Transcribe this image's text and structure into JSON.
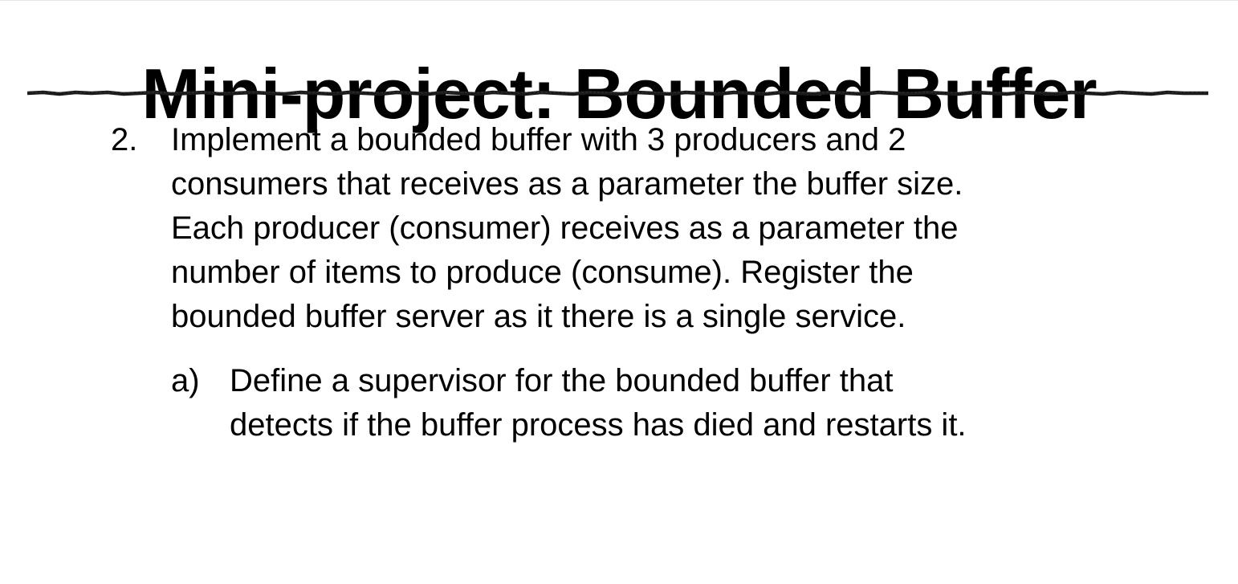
{
  "slide": {
    "title": "Mini-project: Bounded Buffer",
    "item": {
      "number": "2.",
      "text": "Implement a bounded buffer with 3 producers and 2\nconsumers that receives as a parameter the buffer size.\nEach producer (consumer) receives as a parameter the\nnumber of items to produce (consume). Register the\nbounded buffer server as it there is a single service."
    },
    "subitem": {
      "letter": "a)",
      "text": "Define a supervisor for the bounded buffer that\ndetects if the buffer process has died and restarts it."
    }
  }
}
